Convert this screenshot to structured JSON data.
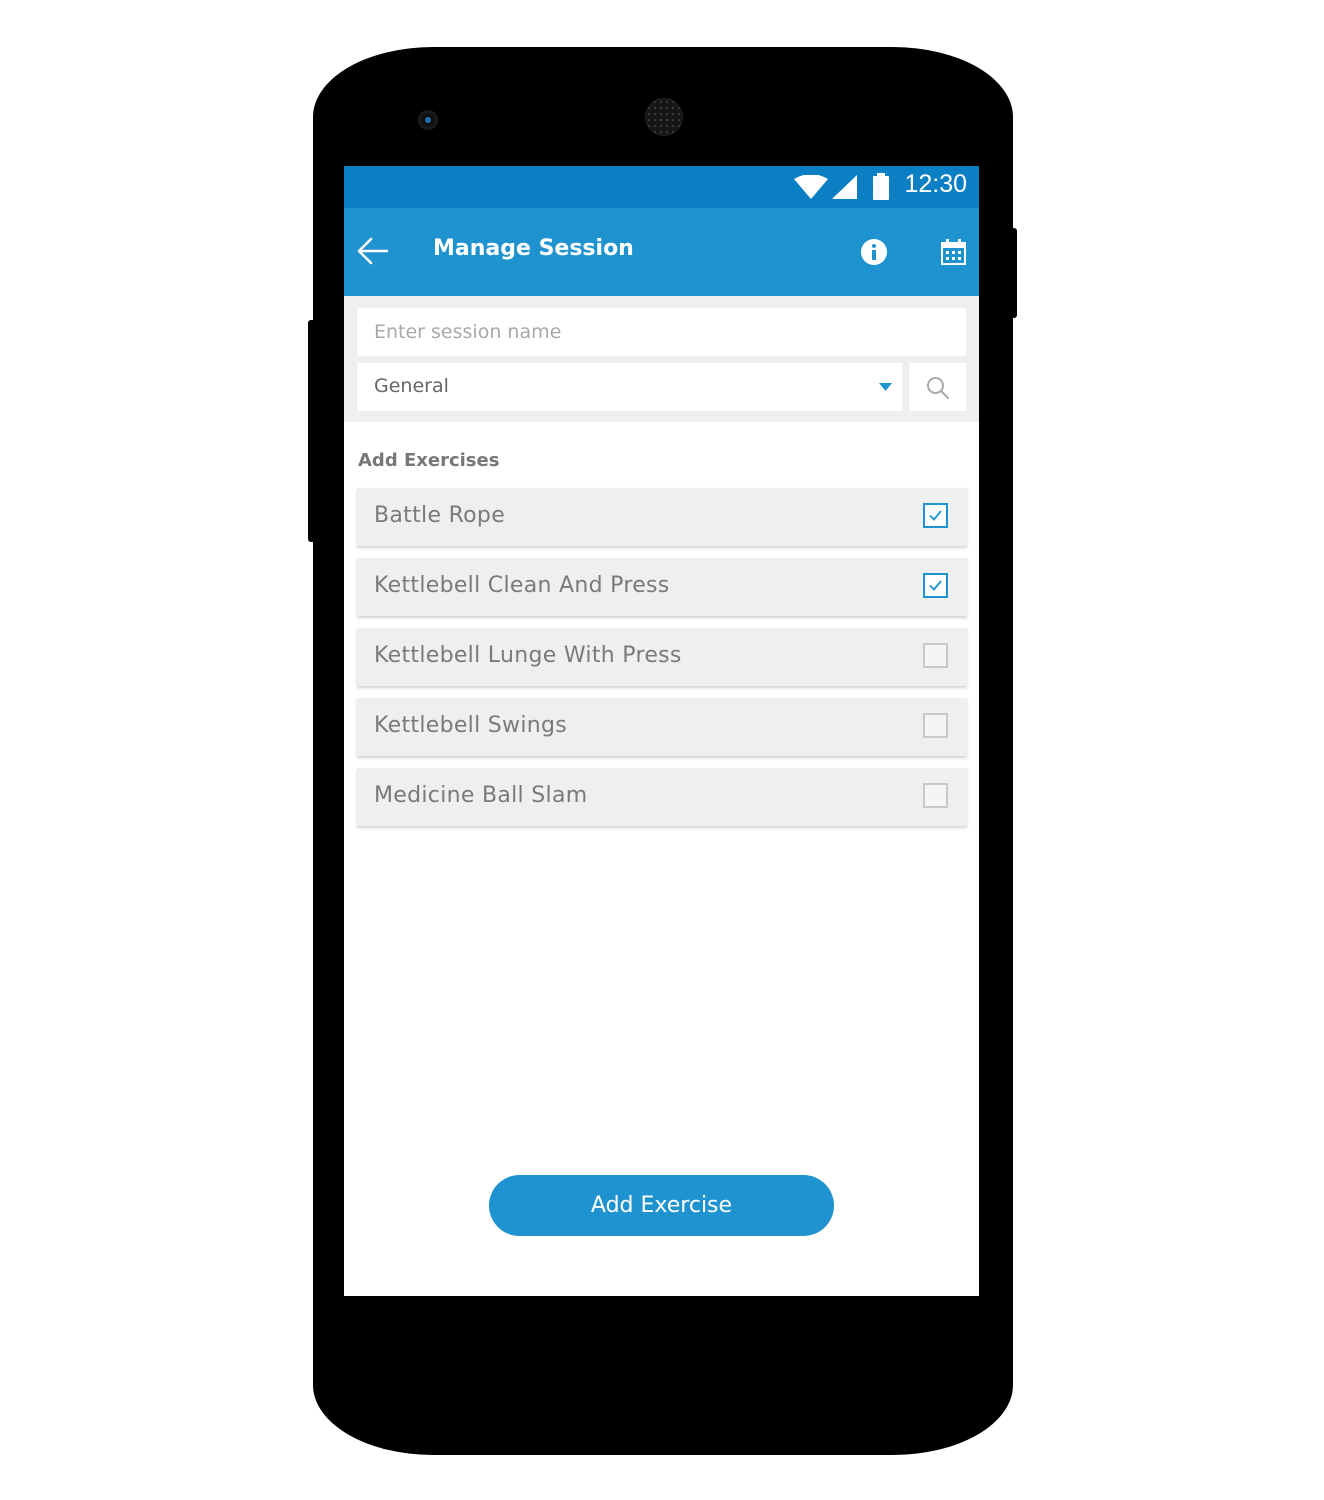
{
  "status_bar": {
    "time": "12:30",
    "icons": [
      "wifi-icon",
      "cellular-signal-icon",
      "battery-icon"
    ]
  },
  "app_bar": {
    "title": "Manage Session",
    "icons": [
      "back-arrow-icon",
      "info-icon",
      "calendar-icon"
    ]
  },
  "form": {
    "session_name_placeholder": "Enter session name",
    "session_name_value": "",
    "category_selected": "General",
    "category_icon": "dropdown-arrow-icon",
    "search_icon": "search-icon"
  },
  "exercises": {
    "section_title": "Add Exercises",
    "items": [
      {
        "name": "Battle Rope",
        "checked": true
      },
      {
        "name": "Kettlebell Clean And Press",
        "checked": true
      },
      {
        "name": "Kettlebell Lunge With Press",
        "checked": false
      },
      {
        "name": "Kettlebell Swings",
        "checked": false
      },
      {
        "name": "Medicine Ball Slam",
        "checked": false
      }
    ]
  },
  "actions": {
    "add_exercise_label": "Add Exercise"
  },
  "colors": {
    "status_bar": "#0b7fc4",
    "primary": "#1f93d0",
    "row_background": "#efefef",
    "text_muted": "#7a7a7a"
  }
}
